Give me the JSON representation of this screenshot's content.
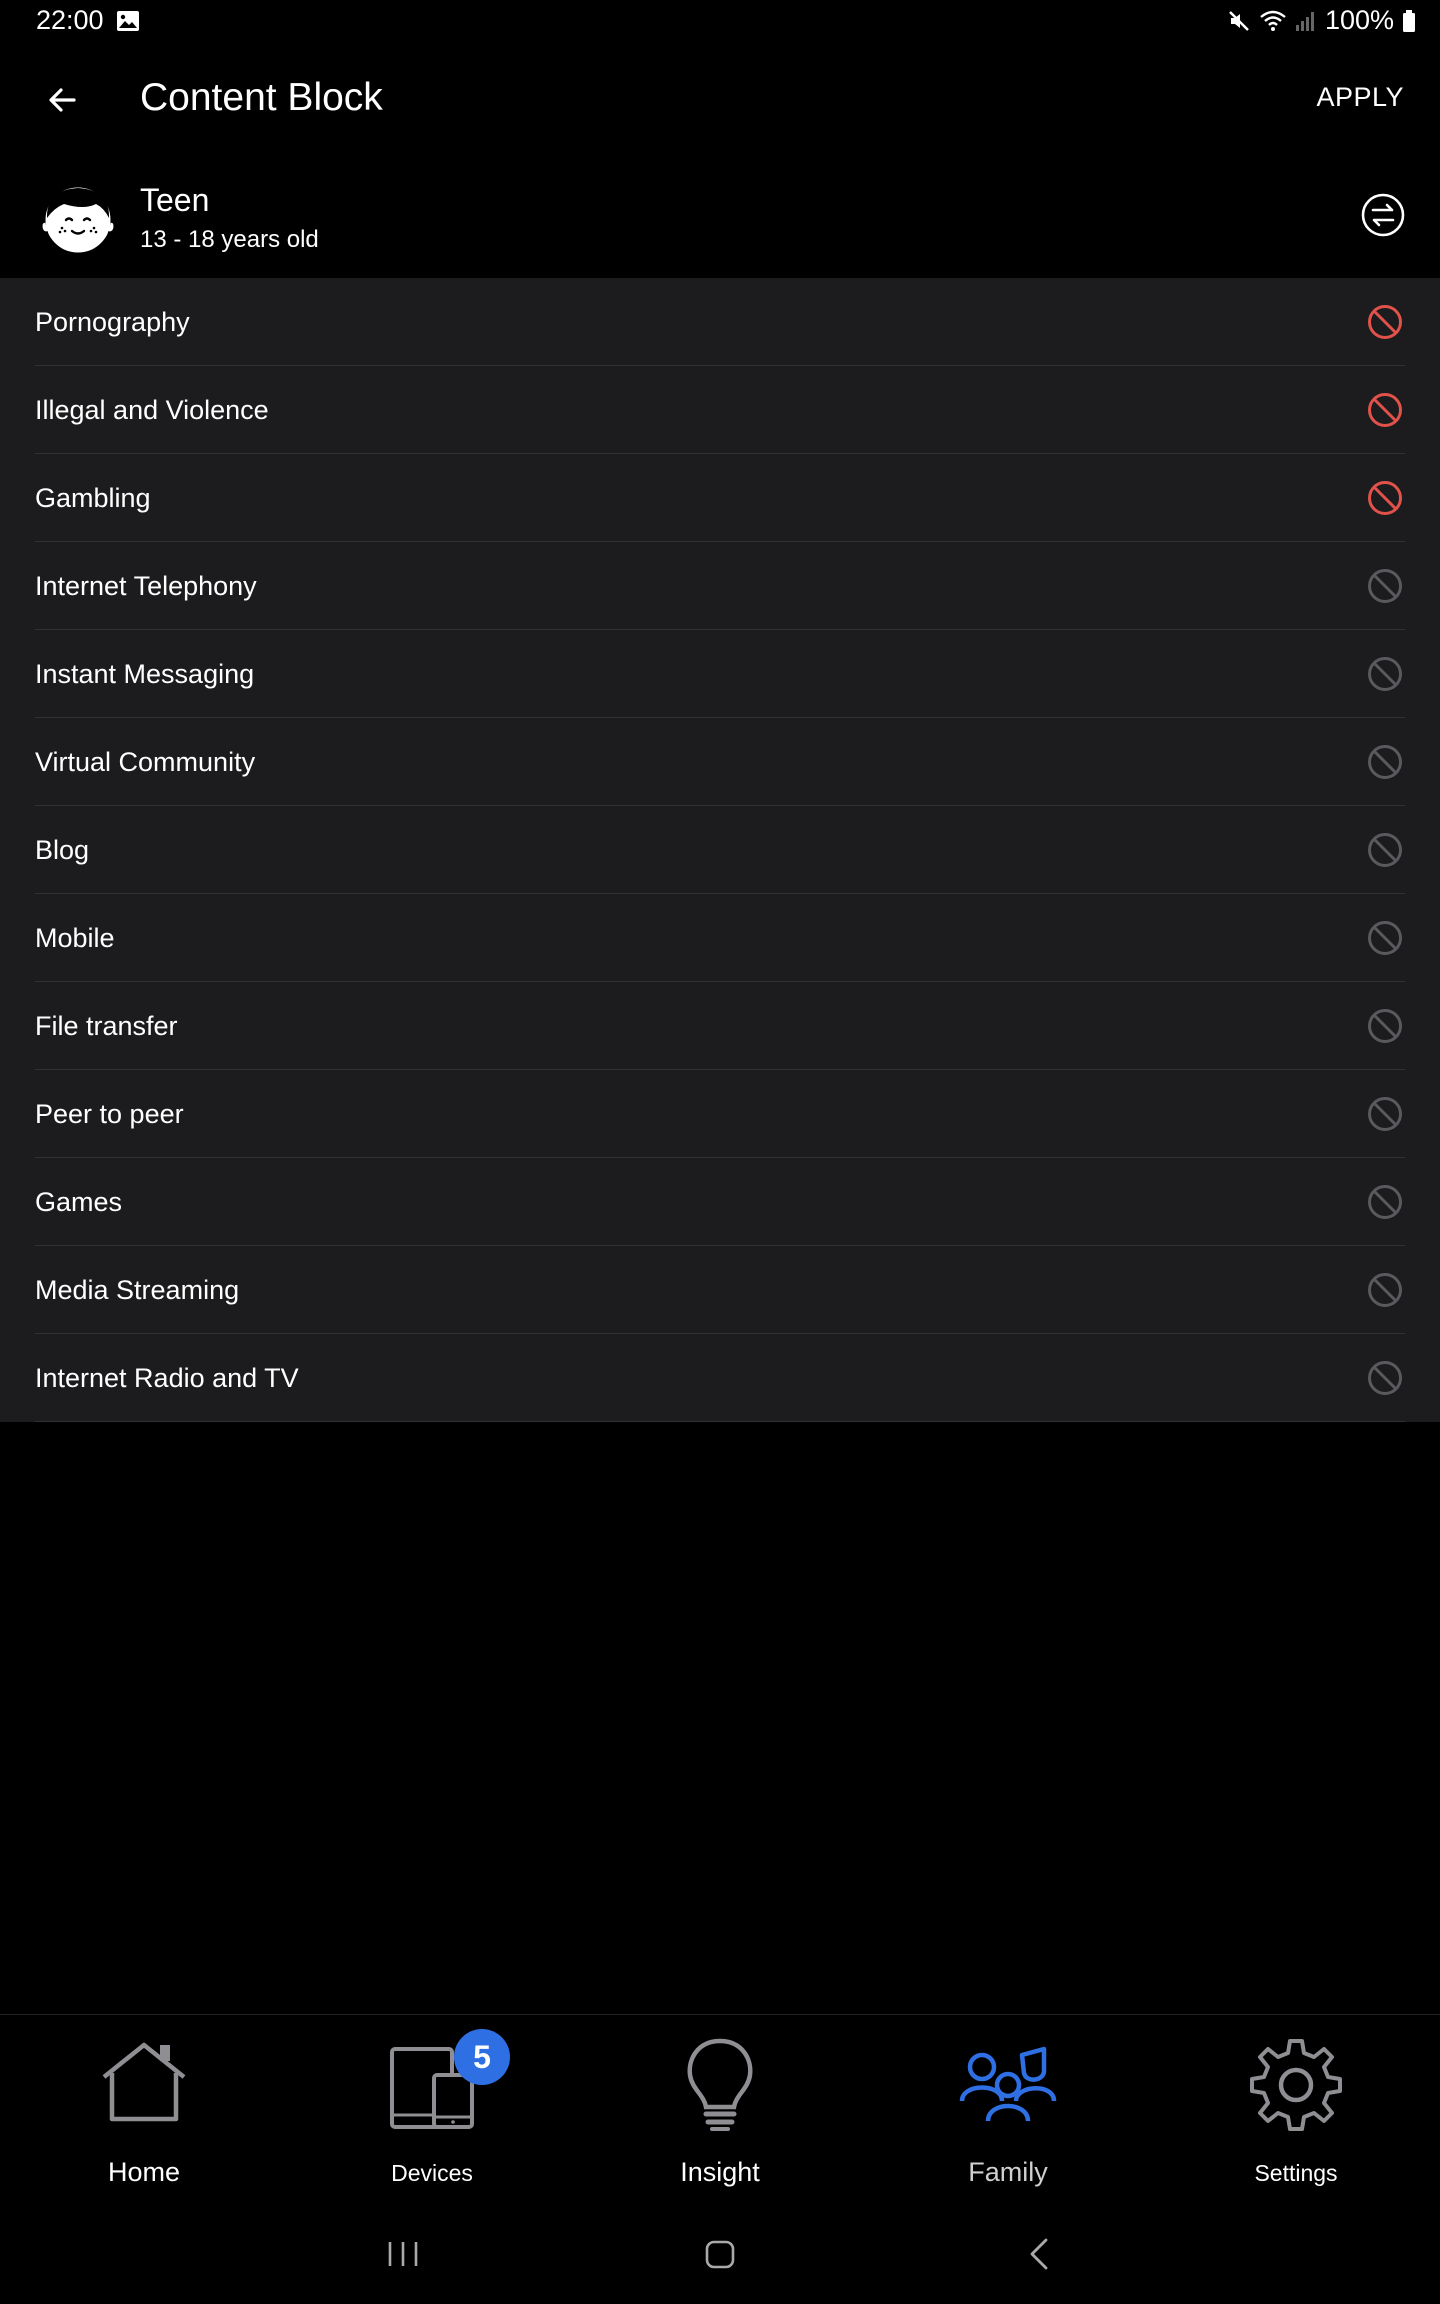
{
  "status_bar": {
    "time": "22:00",
    "battery": "100%",
    "icons": [
      "image-icon",
      "mute-icon",
      "wifi-icon",
      "signal-icon",
      "battery-icon"
    ]
  },
  "app_bar": {
    "title": "Content Block",
    "apply_label": "APPLY",
    "back_icon": "arrow-left-icon"
  },
  "profile": {
    "name": "Teen",
    "age_range": "13 - 18 years old",
    "avatar_icon": "teen-face-icon",
    "switch_icon": "swap-arrows-icon"
  },
  "categories": [
    {
      "label": "Pornography",
      "blocked": true
    },
    {
      "label": "Illegal and Violence",
      "blocked": true
    },
    {
      "label": "Gambling",
      "blocked": true
    },
    {
      "label": "Internet Telephony",
      "blocked": false
    },
    {
      "label": "Instant Messaging",
      "blocked": false
    },
    {
      "label": "Virtual Community",
      "blocked": false
    },
    {
      "label": "Blog",
      "blocked": false
    },
    {
      "label": "Mobile",
      "blocked": false
    },
    {
      "label": "File transfer",
      "blocked": false
    },
    {
      "label": "Peer to peer",
      "blocked": false
    },
    {
      "label": "Games",
      "blocked": false
    },
    {
      "label": "Media Streaming",
      "blocked": false
    },
    {
      "label": "Internet Radio and TV",
      "blocked": false
    }
  ],
  "bottom_nav": {
    "items": [
      {
        "label": "Home",
        "icon": "home-icon"
      },
      {
        "label": "Devices",
        "icon": "devices-icon",
        "badge": "5"
      },
      {
        "label": "Insight",
        "icon": "lightbulb-icon"
      },
      {
        "label": "Family",
        "icon": "family-icon",
        "active": true
      },
      {
        "label": "Settings",
        "icon": "gear-icon"
      }
    ]
  },
  "colors": {
    "background": "#000000",
    "list_background": "#1c1c1e",
    "blocked": "#e0524b",
    "unblocked": "#5a5a5e",
    "accent": "#2f6fe4",
    "nav_icon": "#8e8e93"
  }
}
